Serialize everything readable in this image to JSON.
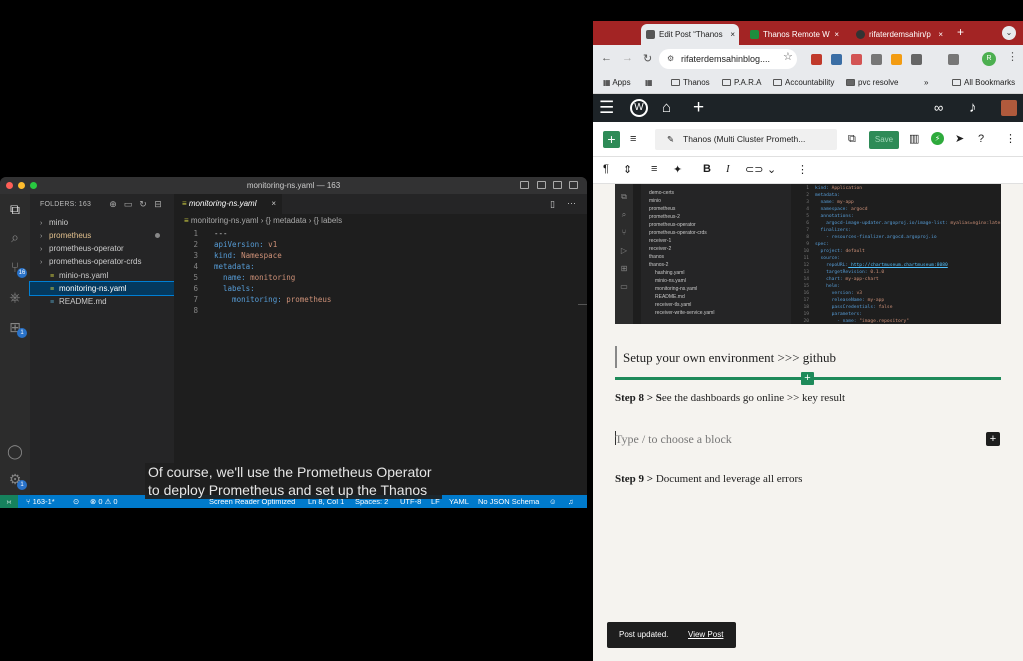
{
  "vscode": {
    "window_title": "monitoring-ns.yaml — 163",
    "sidebar_header": "FOLDERS: 163",
    "tree": [
      {
        "name": "minio",
        "type": "folder"
      },
      {
        "name": "prometheus",
        "type": "folder",
        "modified": true
      },
      {
        "name": "prometheus-operator",
        "type": "folder"
      },
      {
        "name": "prometheus-operator-crds",
        "type": "folder"
      },
      {
        "name": "minio-ns.yaml",
        "type": "file"
      },
      {
        "name": "monitoring-ns.yaml",
        "type": "file",
        "selected": true
      },
      {
        "name": "README.md",
        "type": "file"
      }
    ],
    "tab_label": "monitoring-ns.yaml",
    "breadcrumb": "monitoring-ns.yaml › {} metadata › {} labels",
    "code_lines": [
      {
        "n": "1",
        "key": "---",
        "val": ""
      },
      {
        "n": "2",
        "key": "apiVersion:",
        "val": " v1"
      },
      {
        "n": "3",
        "key": "kind:",
        "val": " Namespace"
      },
      {
        "n": "4",
        "key": "metadata:",
        "val": ""
      },
      {
        "n": "5",
        "key": "  name:",
        "val": " monitoring"
      },
      {
        "n": "6",
        "key": "  labels:",
        "val": ""
      },
      {
        "n": "7",
        "key": "    monitoring:",
        "val": " prometheus"
      },
      {
        "n": "8",
        "key": "",
        "val": ""
      }
    ],
    "activity_badges": {
      "source_control": "16",
      "extensions": "1",
      "settings": "1"
    },
    "status": {
      "branch": "163-1*",
      "problems": "⊗ 0 ⚠ 0",
      "screen_reader": "Screen Reader Optimized",
      "position": "Ln 8, Col 1",
      "spaces": "Spaces: 2",
      "encoding": "UTF-8",
      "eol": "LF",
      "language": "YAML",
      "schema": "No JSON Schema"
    },
    "caption": "Of course, we'll use the Prometheus Operator to deploy Prometheus and set up the Thanos"
  },
  "chrome": {
    "tabs": [
      {
        "label": "Edit Post “Thanos",
        "active": true
      },
      {
        "label": "Thanos Remote W",
        "active": false
      },
      {
        "label": "rifaterdemsahin/p",
        "active": false
      }
    ],
    "url": "rifaterdemsahinblog....",
    "profile_initial": "R",
    "bookmarks": [
      "Apps",
      "Thanos",
      "P.A.R.A",
      "Accountability",
      "pvc resolve",
      "All Bookmarks"
    ],
    "colors": {
      "tabstrip": "#a32424",
      "wp_green": "#2e8b57"
    }
  },
  "wp": {
    "doc_title": "Thanos (Multi Cluster Prometh...",
    "save_label": "Save",
    "setup_text": "Setup your own environment >>> github",
    "step8_prefix": "Step 8 > S",
    "step8_rest": "ee the dashboards go online >> key result",
    "placeholder": "Type / to choose a block",
    "step9_prefix": "Step 9 >",
    "step9_rest": "  Document and leverage all errors",
    "snackbar_msg": "Post updated.",
    "snackbar_link": "View Post"
  },
  "embedded": {
    "files": [
      "demo-certs",
      "minio",
      "prometheus",
      "prometheus-2",
      "prometheus-operator",
      "prometheus-operator-crds",
      "receiver-1",
      "receiver-2",
      "thanos",
      "thanos-2",
      "hashing.yaml",
      "minio-ns.yaml",
      "monitoring-ns.yaml",
      "README.md",
      "receiver-tls.yaml",
      "receiver-write-service.yaml"
    ],
    "lines": [
      {
        "n": "1",
        "k": "kind:",
        "v": " Application"
      },
      {
        "n": "2",
        "k": "metadata:",
        "v": ""
      },
      {
        "n": "3",
        "k": "  name:",
        "v": " my-app"
      },
      {
        "n": "4",
        "k": "  namespace:",
        "v": " argocd"
      },
      {
        "n": "5",
        "k": "  annotations:",
        "v": ""
      },
      {
        "n": "6",
        "k": "    argocd-image-updater.argoproj.io/image-list:",
        "v": " myalias=nginx:latest"
      },
      {
        "n": "7",
        "k": "  finalizers:",
        "v": ""
      },
      {
        "n": "8",
        "k": "    - resources-finalizer.argocd.argoproj.io",
        "v": ""
      },
      {
        "n": "9",
        "k": "spec:",
        "v": ""
      },
      {
        "n": "10",
        "k": "  project:",
        "v": " default"
      },
      {
        "n": "11",
        "k": "  source:",
        "v": ""
      },
      {
        "n": "12",
        "k": "    repoURL:",
        "v": " http://chartmuseum.chartmuseum:8080"
      },
      {
        "n": "13",
        "k": "    targetRevision:",
        "v": " 0.1.0"
      },
      {
        "n": "14",
        "k": "    chart:",
        "v": " my-app-chart"
      },
      {
        "n": "15",
        "k": "    helm:",
        "v": ""
      },
      {
        "n": "16",
        "k": "      version:",
        "v": " v3"
      },
      {
        "n": "17",
        "k": "      releaseName:",
        "v": " my-app"
      },
      {
        "n": "18",
        "k": "      passCredentials:",
        "v": " false"
      },
      {
        "n": "19",
        "k": "      parameters:",
        "v": ""
      },
      {
        "n": "20",
        "k": "        - name:",
        "v": " \"image.repository\""
      }
    ]
  }
}
